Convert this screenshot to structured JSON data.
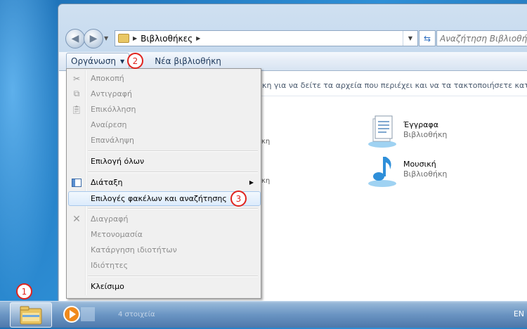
{
  "window": {
    "address": {
      "breadcrumb": "Βιβλιοθήκες",
      "search_placeholder": "Αναζήτηση Βιβλιοθή"
    },
    "toolbar": {
      "organize_label": "Οργάνωση",
      "new_library_label": "Νέα βιβλιοθήκη"
    },
    "content": {
      "description": "ήκη για να δείτε τα αρχεία που περιέχει και να τα τακτοποιήσετε κατά φ",
      "libraries": [
        {
          "name": "Έγγραφα",
          "subtitle": "Βιβλιοθήκη",
          "icon": "documents-library-icon"
        },
        {
          "name": "Μουσική",
          "subtitle": "Βιβλιοθήκη",
          "icon": "music-library-icon"
        }
      ],
      "truncated_left": [
        "κη",
        "κη"
      ]
    }
  },
  "menu": {
    "items": [
      {
        "label": "Αποκοπή",
        "icon": "cut-icon",
        "enabled": false
      },
      {
        "label": "Αντιγραφή",
        "icon": "copy-icon",
        "enabled": false
      },
      {
        "label": "Επικόλληση",
        "icon": "paste-icon",
        "enabled": false
      },
      {
        "label": "Αναίρεση",
        "enabled": false
      },
      {
        "label": "Επανάληψη",
        "enabled": false
      },
      {
        "label": "Επιλογή όλων",
        "enabled": true
      },
      {
        "label": "Διάταξη",
        "icon": "layout-icon",
        "enabled": true,
        "submenu": true
      },
      {
        "label": "Επιλογές φακέλων και αναζήτησης",
        "enabled": true,
        "highlighted": true
      },
      {
        "label": "Διαγραφή",
        "icon": "delete-icon",
        "enabled": false
      },
      {
        "label": "Μετονομασία",
        "enabled": false
      },
      {
        "label": "Κατάργηση ιδιοτήτων",
        "enabled": false
      },
      {
        "label": "Ιδιότητες",
        "enabled": false
      },
      {
        "label": "Κλείσιμο",
        "enabled": true
      }
    ]
  },
  "markers": [
    "1",
    "2",
    "3"
  ],
  "taskbar": {
    "tray_text": "EN",
    "blurred_label": "4 στοιχεία",
    "items": [
      {
        "name": "windows-explorer-icon",
        "active": true
      },
      {
        "name": "media-player-icon",
        "active": false
      }
    ]
  },
  "colors": {
    "marker_red": "#e0231d",
    "disabled_text": "#8d8d8d",
    "toolbar_text": "#1e395b"
  }
}
